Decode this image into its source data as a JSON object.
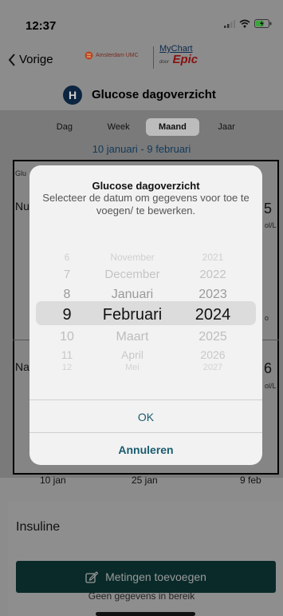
{
  "status_bar": {
    "time": "12:37"
  },
  "nav": {
    "back_label": "Vorige",
    "logo_amc": "Amsterdam UMC",
    "logo_mychart": "MyChart",
    "logo_epic_prefix": "door",
    "logo_epic": "Epic"
  },
  "header": {
    "badge": "H",
    "title": "Glucose dagoverzicht"
  },
  "segmented": {
    "items": [
      {
        "label": "Dag"
      },
      {
        "label": "Week"
      },
      {
        "label": "Maand"
      },
      {
        "label": "Jaar"
      }
    ],
    "selected": "Maand"
  },
  "date_range": "10 januari - 9 februari",
  "background_fragments": {
    "row1_left": "Glu",
    "row2_left": "Nu",
    "row2_right": "5",
    "row2_unit": "ol/L",
    "row3_right": "o",
    "row4_left": "Na",
    "row4_right": "6",
    "row4_unit": "ol/L"
  },
  "chart_axis": {
    "x_ticks": [
      "10 jan",
      "25 jan",
      "9 feb"
    ]
  },
  "modal": {
    "title": "Glucose dagoverzicht",
    "subtitle": "Selecteer de datum om gegevens voor toe te voegen/ te bewerken.",
    "picker": {
      "rows": [
        {
          "day": "6",
          "month": "November",
          "year": "2021"
        },
        {
          "day": "7",
          "month": "December",
          "year": "2022"
        },
        {
          "day": "8",
          "month": "Januari",
          "year": "2023"
        },
        {
          "day": "9",
          "month": "Februari",
          "year": "2024"
        },
        {
          "day": "10",
          "month": "Maart",
          "year": "2025"
        },
        {
          "day": "11",
          "month": "April",
          "year": "2026"
        },
        {
          "day": "12",
          "month": "Mei",
          "year": "2027"
        }
      ],
      "selected": {
        "day": "9",
        "month": "Februari",
        "year": "2024"
      }
    },
    "ok_label": "OK",
    "cancel_label": "Annuleren"
  },
  "insuline": {
    "title": "Insuline",
    "add_button": "Metingen toevoegen",
    "no_data": "Geen gegevens in bereik"
  }
}
